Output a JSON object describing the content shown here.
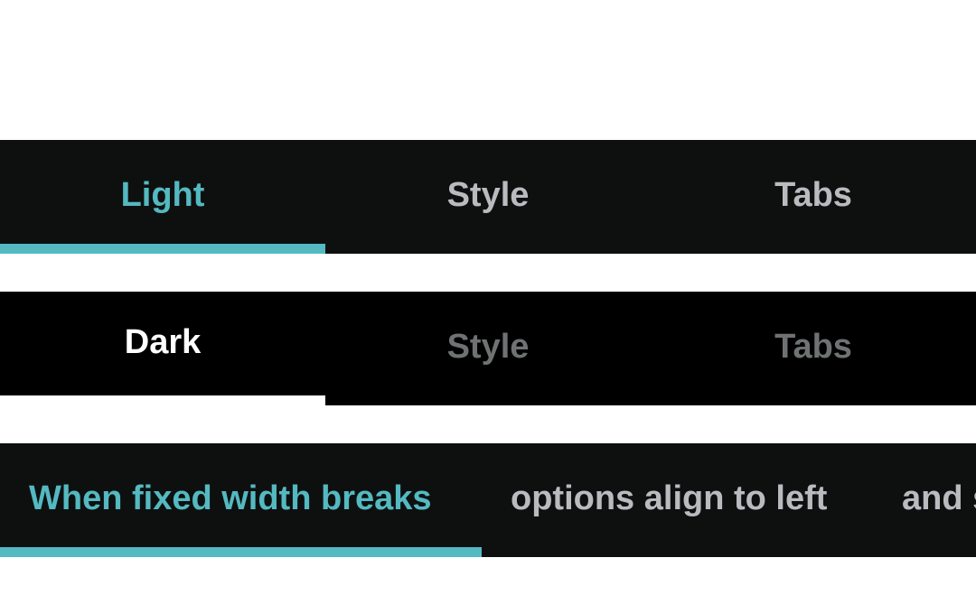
{
  "light_bar": {
    "tabs": [
      {
        "label": "Light",
        "active": true
      },
      {
        "label": "Style",
        "active": false
      },
      {
        "label": "Tabs",
        "active": false
      }
    ]
  },
  "dark_bar": {
    "tabs": [
      {
        "label": "Dark",
        "active": true
      },
      {
        "label": "Style",
        "active": false
      },
      {
        "label": "Tabs",
        "active": false
      }
    ]
  },
  "scroll_bar": {
    "tabs": [
      {
        "label": "When fixed width breaks",
        "active": true
      },
      {
        "label": "options align to left",
        "active": false
      },
      {
        "label": "and scroll",
        "active": false
      }
    ]
  },
  "colors": {
    "accent": "#54b9c1",
    "bar_bg_light": "#0e1010",
    "bar_bg_dark": "#000000",
    "inactive_text_light": "#b9bcbf",
    "inactive_text_dark": "#6f7273",
    "dark_active": "#ffffff"
  }
}
